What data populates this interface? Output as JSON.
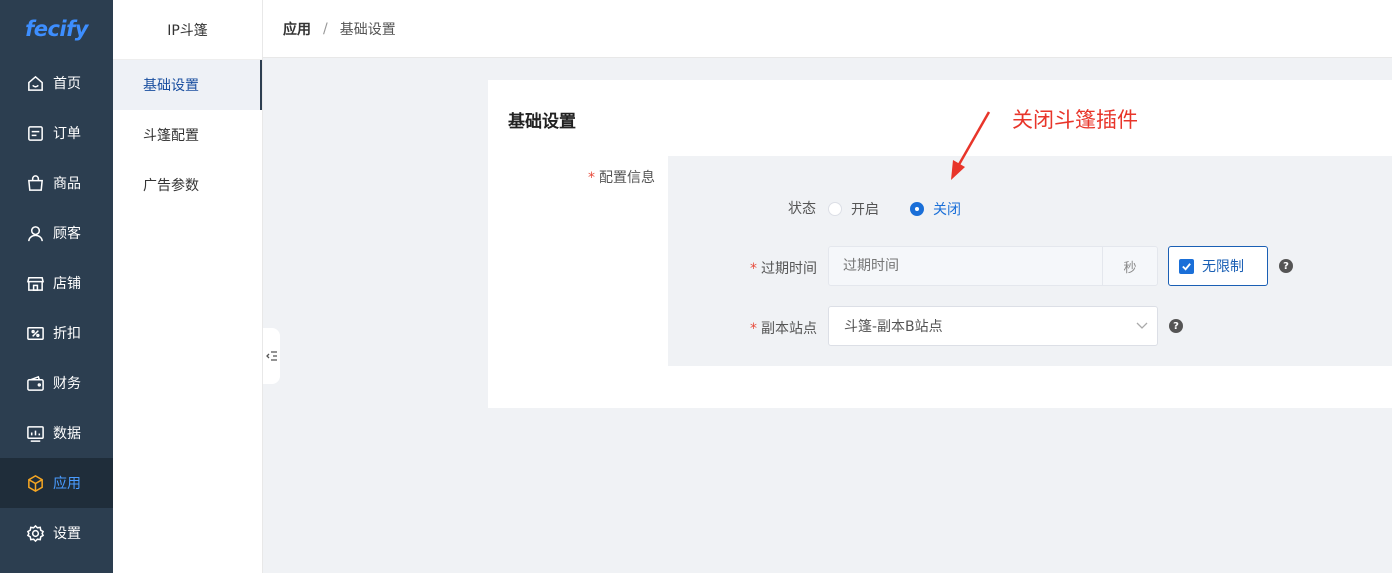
{
  "app": {
    "logo": "fecify"
  },
  "nav": {
    "items": [
      {
        "label": "首页",
        "icon": "home-icon"
      },
      {
        "label": "订单",
        "icon": "order-icon"
      },
      {
        "label": "商品",
        "icon": "shopping-bag-icon"
      },
      {
        "label": "顾客",
        "icon": "user-icon"
      },
      {
        "label": "店铺",
        "icon": "store-icon"
      },
      {
        "label": "折扣",
        "icon": "discount-icon"
      },
      {
        "label": "财务",
        "icon": "wallet-icon"
      },
      {
        "label": "数据",
        "icon": "data-icon"
      },
      {
        "label": "应用",
        "icon": "cube-icon",
        "active": true
      },
      {
        "label": "设置",
        "icon": "gear-icon"
      }
    ]
  },
  "submenu": {
    "title": "IP斗篷",
    "items": [
      {
        "label": "基础设置",
        "active": true
      },
      {
        "label": "斗篷配置"
      },
      {
        "label": "广告参数"
      }
    ]
  },
  "breadcrumb": {
    "root": "应用",
    "separator": "/",
    "current": "基础设置"
  },
  "card": {
    "title": "基础设置",
    "config_label": "配置信息",
    "status": {
      "label": "状态",
      "options": [
        {
          "label": "开启",
          "checked": false
        },
        {
          "label": "关闭",
          "checked": true
        }
      ]
    },
    "expire": {
      "label": "过期时间",
      "placeholder": "过期时间",
      "suffix": "秒",
      "unlimited_label": "无限制",
      "unlimited_checked": true
    },
    "mirror_site": {
      "label": "副本站点",
      "value": "斗篷-副本B站点"
    }
  },
  "annotation": {
    "text": "关闭斗篷插件"
  },
  "colors": {
    "accent": "#1a6fd8",
    "nav_bg": "#2c3e50",
    "annotation": "#e8352a"
  }
}
